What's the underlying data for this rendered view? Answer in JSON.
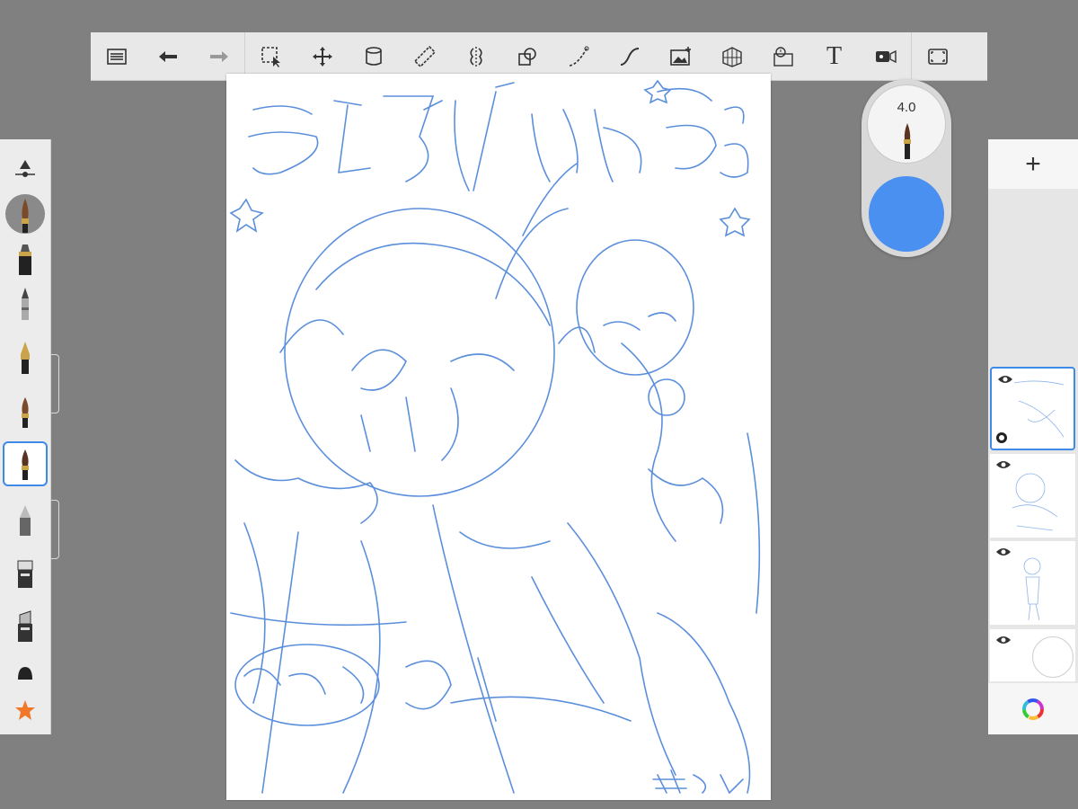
{
  "toolbar": {
    "items": [
      {
        "name": "menu-list-icon"
      },
      {
        "name": "undo-icon"
      },
      {
        "name": "redo-icon"
      },
      {
        "name": "selection-icon"
      },
      {
        "name": "transform-move-icon"
      },
      {
        "name": "fill-bucket-icon"
      },
      {
        "name": "ruler-icon"
      },
      {
        "name": "symmetry-icon"
      },
      {
        "name": "shape-icon"
      },
      {
        "name": "curve-icon"
      },
      {
        "name": "stroke-icon"
      },
      {
        "name": "add-image-icon"
      },
      {
        "name": "perspective-grid-icon"
      },
      {
        "name": "time-lapse-icon"
      },
      {
        "name": "text-icon",
        "label": "T"
      },
      {
        "name": "video-icon"
      },
      {
        "name": "fullscreen-icon"
      }
    ]
  },
  "puck": {
    "brush_size": "4.0",
    "color": "#4a90f0"
  },
  "brushes": [
    {
      "name": "opacity-slider-icon"
    },
    {
      "name": "paintbrush-icon"
    },
    {
      "name": "marker-icon"
    },
    {
      "name": "pencil-icon"
    },
    {
      "name": "ink-pen-icon"
    },
    {
      "name": "paintbrush-small-icon"
    },
    {
      "name": "paintbrush-selected-icon"
    },
    {
      "name": "airbrush-icon"
    },
    {
      "name": "eraser-icon"
    },
    {
      "name": "eraser-hard-icon"
    },
    {
      "name": "smudge-icon"
    },
    {
      "name": "favorites-star-icon"
    }
  ],
  "layers": {
    "add_label": "+",
    "count": 4
  },
  "accent": "#3d8be6",
  "sketch_color": "#5b8fdc"
}
